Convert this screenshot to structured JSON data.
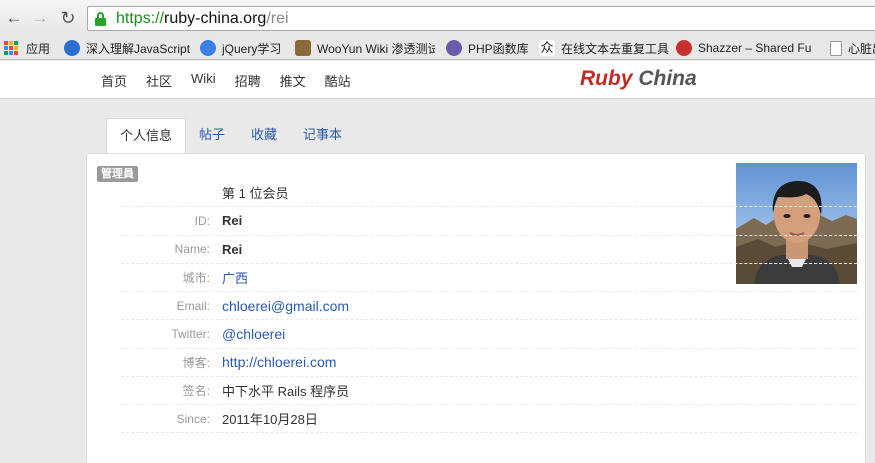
{
  "browser": {
    "url_scheme": "https://",
    "url_host": "ruby-china.org",
    "url_path": "/rei"
  },
  "bookmarks": [
    {
      "label": "应用",
      "icon": "apps-grid-icon"
    },
    {
      "label": "深入理解JavaScript",
      "icon": "bookmark-site-icon"
    },
    {
      "label": "jQuery学习",
      "icon": "bookmark-site-icon"
    },
    {
      "label": "WooYun Wiki 渗透测试",
      "icon": "wooyun-icon"
    },
    {
      "label": "PHP函数库",
      "icon": "php-icon"
    },
    {
      "label": "在线文本去重复工具",
      "icon": "text-tool-icon"
    },
    {
      "label": "Shazzer – Shared Fu",
      "icon": "shazzer-icon"
    },
    {
      "label": "心脏出",
      "icon": "document-icon"
    }
  ],
  "site": {
    "nav": [
      "首页",
      "社区",
      "Wiki",
      "招聘",
      "推文",
      "酷站"
    ],
    "logo_ruby": "Ruby",
    "logo_china": "China"
  },
  "tabs": [
    {
      "label": "个人信息",
      "active": true
    },
    {
      "label": "帖子",
      "active": false
    },
    {
      "label": "收藏",
      "active": false
    },
    {
      "label": "记事本",
      "active": false
    }
  ],
  "profile": {
    "role_badge": "管理員",
    "rows": [
      {
        "label": "",
        "value": "第 1 位会员"
      },
      {
        "label": "ID:",
        "value": "Rei"
      },
      {
        "label": "Name:",
        "value": "Rei"
      },
      {
        "label": "城市:",
        "value": "广西"
      },
      {
        "label": "Email:",
        "value": "chloerei@gmail.com"
      },
      {
        "label": "Twitter:",
        "value": "@chloerei"
      },
      {
        "label": "博客:",
        "value": "http://chloerei.com"
      },
      {
        "label": "签名:",
        "value": "中下水平 Rails 程序员"
      },
      {
        "label": "Since:",
        "value": "2011年10月28日"
      }
    ]
  },
  "colors": {
    "link": "#2a5ab0",
    "logo_red": "#c32b22",
    "secure_green": "#199019"
  }
}
